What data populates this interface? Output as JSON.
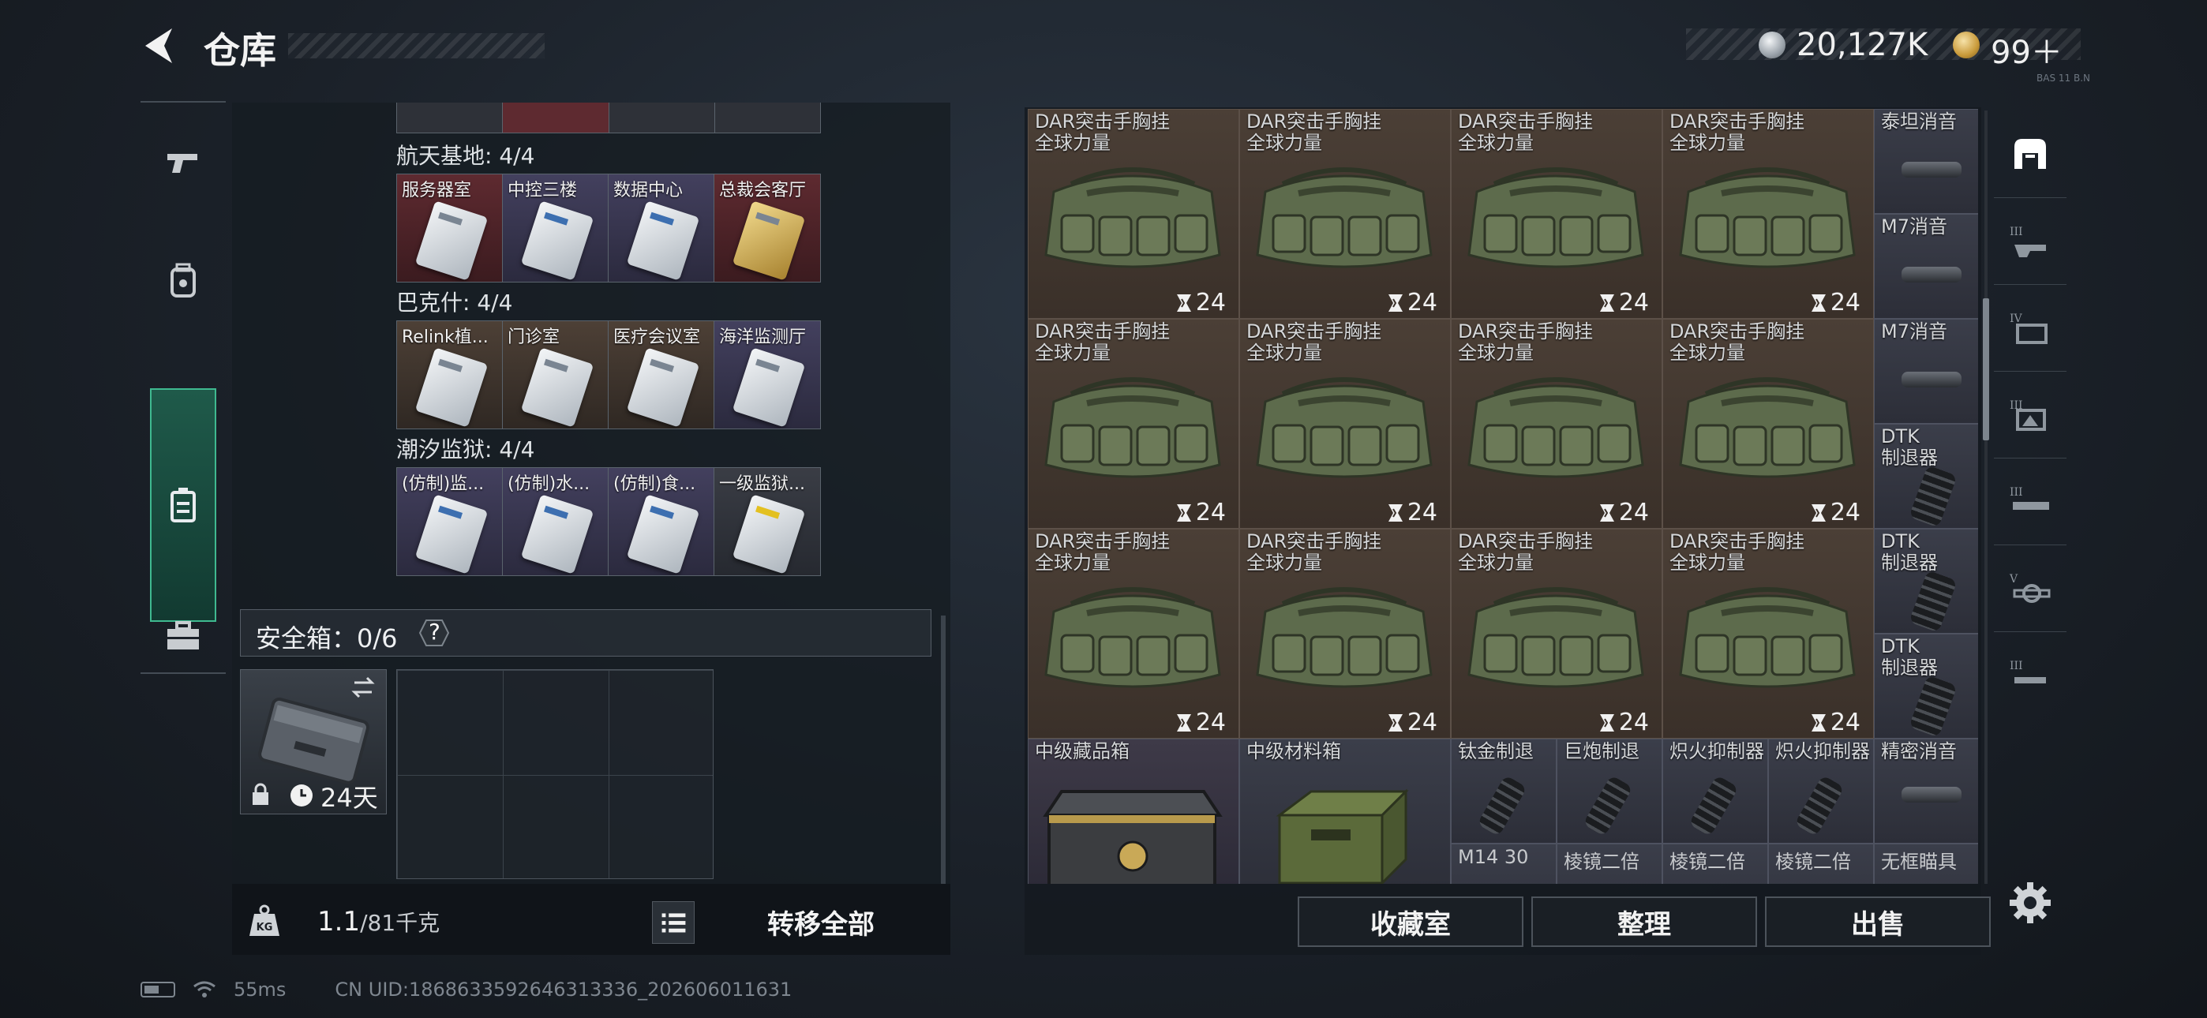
{
  "header": {
    "title": "仓库"
  },
  "currency": {
    "coins": "20,127K",
    "tokens": "99＋"
  },
  "version_tag": "BAS 11 B.N",
  "left_panel": {
    "groups": [
      {
        "label": "航天基地: 4/4",
        "cards": [
          "服务器室",
          "中控三楼",
          "数据中心",
          "总裁会客厅"
        ]
      },
      {
        "label": "巴克什: 4/4",
        "cards": [
          "Relink植...",
          "门诊室",
          "医疗会议室",
          "海洋监测厅"
        ]
      },
      {
        "label": "潮汐监狱: 4/4",
        "cards": [
          "(仿制)监...",
          "(仿制)水...",
          "(仿制)食...",
          "一级监狱..."
        ]
      }
    ],
    "safe_box": {
      "label": "安全箱：0/6",
      "help": "?",
      "days": "24天"
    },
    "weight": {
      "current": "1.1",
      "max": "/81千克"
    },
    "transfer_all": "转移全部"
  },
  "inventory": {
    "bag_name_line1": "DAR突击手胸挂",
    "bag_name_line2": "全球力量",
    "bag_count": "24",
    "side_items": [
      {
        "name": "泰坦消音"
      },
      {
        "name": "M7消音"
      },
      {
        "name": "M7消音"
      },
      {
        "name": "DTK\n制退器"
      },
      {
        "name": "DTK\n制退器"
      },
      {
        "name": "DTK\n制退器"
      }
    ],
    "bottom_row": {
      "box1": "中级藏品箱",
      "box2": "中级材料箱",
      "items": [
        "钛金制退",
        "巨炮制退",
        "炽火抑制器",
        "炽火抑制器",
        "精密消音"
      ],
      "next_row": [
        "M14 30",
        "棱镜二倍",
        "棱镜二倍",
        "棱镜二倍",
        "无框瞄具"
      ]
    }
  },
  "actions": {
    "collection": "收藏室",
    "organize": "整理",
    "sell": "出售"
  },
  "status": {
    "ping": "55ms",
    "uid": "CN UID:1868633592646313336_202606011631"
  }
}
